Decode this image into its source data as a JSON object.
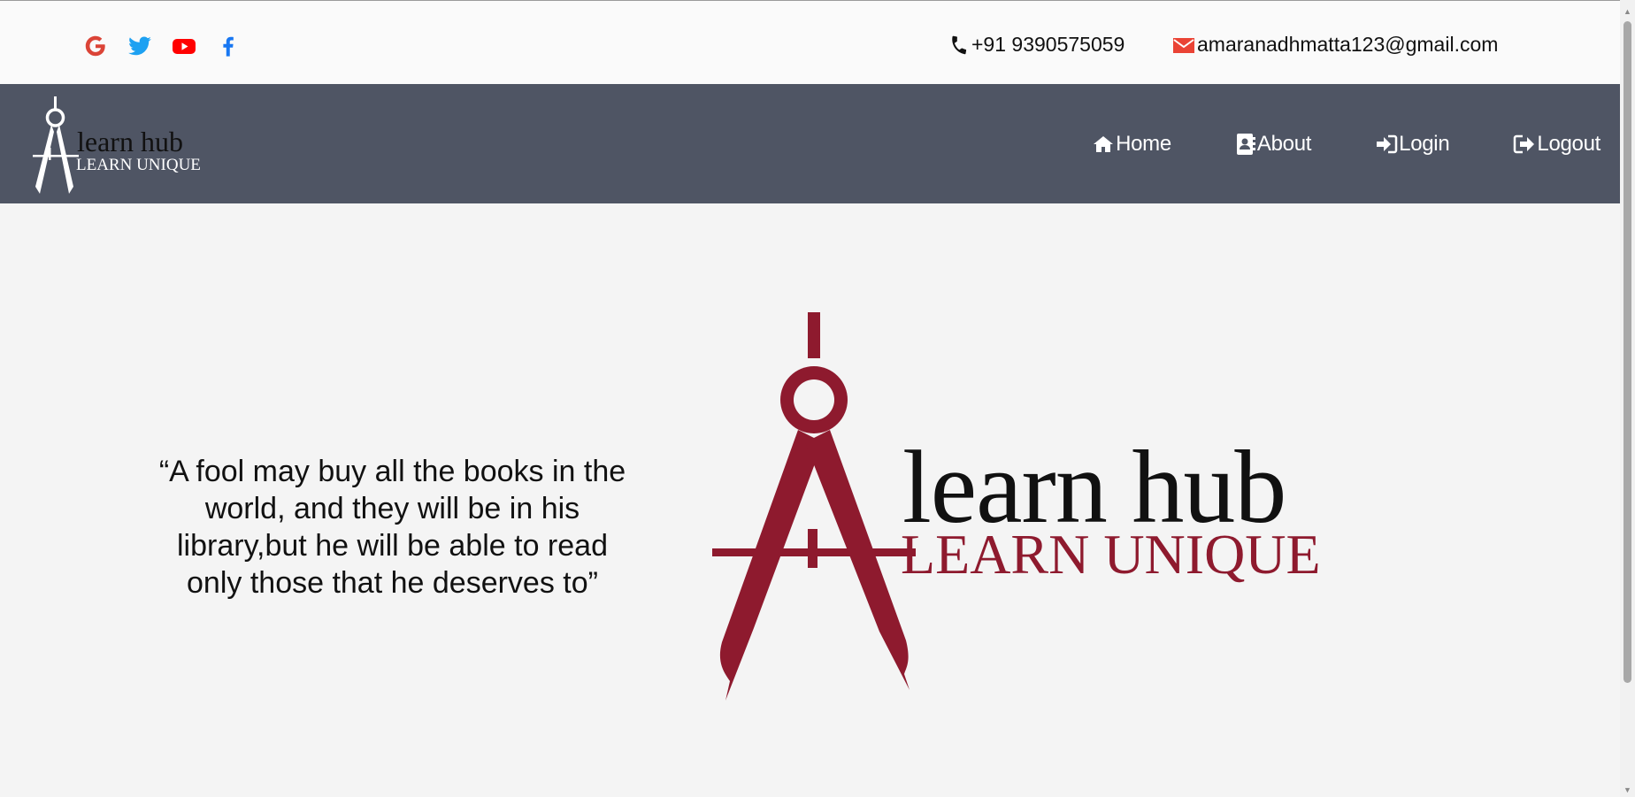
{
  "topbar": {
    "social_icons": [
      "google-icon",
      "twitter-icon",
      "youtube-icon",
      "facebook-icon"
    ],
    "phone": "+91 9390575059",
    "email": "amaranadhmatta123@gmail.com"
  },
  "brand": {
    "name": "learn hub",
    "tagline": "LEARN UNIQUE"
  },
  "nav": {
    "home": "Home",
    "about": "About",
    "login": "Login",
    "logout": "Logout"
  },
  "hero": {
    "quote": "“A fool may buy all the books in the world, and they will be in his library,but he will be able to read only those that he deserves to”"
  },
  "colors": {
    "topbar_bg": "#fafafa",
    "navbar_bg": "#4f5564",
    "hero_bg": "#f4f4f4",
    "brand_red": "#8e1a2e",
    "google": "#db4437",
    "twitter": "#1da1f2",
    "youtube": "#ff0000",
    "facebook": "#1877f2",
    "mail_red": "#ea4335"
  }
}
